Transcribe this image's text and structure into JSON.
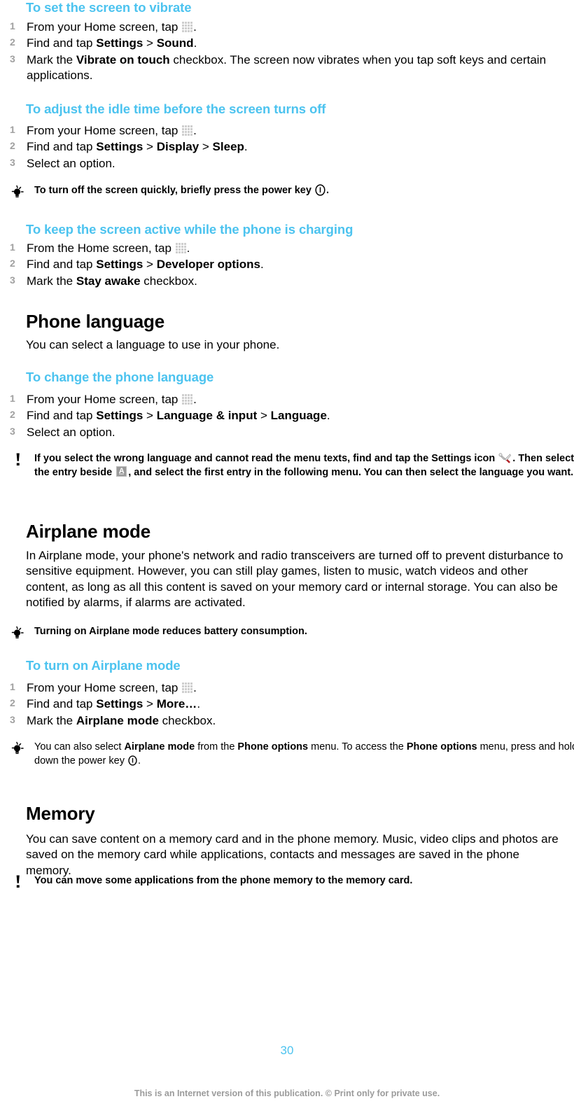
{
  "document": {
    "page_number": "30",
    "footer_note": "This is an Internet version of this publication. © Print only for private use.",
    "accent_color": "#4cc3ef",
    "step_number_color": "#a0a0a0"
  },
  "icons": {
    "app_drawer": "app-drawer-grid-icon",
    "power_key": "power-key-icon",
    "settings_wrench": "settings-wrench-icon",
    "keyboard_a": "keyboard-language-icon",
    "tip": "tip-lightbulb-icon",
    "note": "note-exclamation-icon"
  },
  "procedures": {
    "vibrate": {
      "title": "To set the screen to vibrate",
      "steps": [
        {
          "num": "1",
          "pre": "From your Home screen, tap ",
          "icon": "app_drawer",
          "post": "."
        },
        {
          "num": "2",
          "pre": "Find and tap ",
          "bold1": "Settings",
          "sep": " > ",
          "bold2": "Sound",
          "post": "."
        },
        {
          "num": "3",
          "pre": "Mark the ",
          "bold1": "Vibrate on touch",
          "post": " checkbox. The screen now vibrates when you tap soft keys and certain applications."
        }
      ]
    },
    "idle_time": {
      "title": "To adjust the idle time before the screen turns off",
      "steps": [
        {
          "num": "1",
          "pre": "From your Home screen, tap ",
          "icon": "app_drawer",
          "post": "."
        },
        {
          "num": "2",
          "pre": "Find and tap ",
          "bold1": "Settings",
          "sep": " > ",
          "bold2": "Display",
          "sep2": " > ",
          "bold3": "Sleep",
          "post": "."
        },
        {
          "num": "3",
          "pre": "Select an option.",
          "post": ""
        }
      ],
      "tip": {
        "type": "tip",
        "pre": "To turn off the screen quickly, briefly press the power key ",
        "icon": "power_key",
        "post": "."
      }
    },
    "screen_active": {
      "title": "To keep the screen active while the phone is charging",
      "steps": [
        {
          "num": "1",
          "pre": "From the Home screen, tap ",
          "icon": "app_drawer",
          "post": "."
        },
        {
          "num": "2",
          "pre": "Find and tap ",
          "bold1": "Settings",
          "sep": " > ",
          "bold2": "Developer options",
          "post": "."
        },
        {
          "num": "3",
          "pre": "Mark the ",
          "bold1": "Stay awake",
          "post": " checkbox."
        }
      ]
    },
    "change_language": {
      "title": "To change the phone language",
      "steps": [
        {
          "num": "1",
          "pre": "From your Home screen, tap ",
          "icon": "app_drawer",
          "post": "."
        },
        {
          "num": "2",
          "pre": "Find and tap ",
          "bold1": "Settings",
          "sep": " > ",
          "bold2": "Language & input",
          "sep2": " > ",
          "bold3": "Language",
          "post": "."
        },
        {
          "num": "3",
          "pre": "Select an option.",
          "post": ""
        }
      ],
      "note": {
        "type": "note",
        "part1": "If you select the wrong language and cannot read the menu texts, find and tap the ",
        "bold1": "Settings",
        "part2": " icon ",
        "icon1": "settings_wrench",
        "part3": ". Then select the entry beside ",
        "icon2": "keyboard_a",
        "part4": ", and select the first entry in the following menu. You can then select the language you want."
      }
    },
    "airplane_on": {
      "title": "To turn on Airplane mode",
      "steps": [
        {
          "num": "1",
          "pre": "From your Home screen, tap ",
          "icon": "app_drawer",
          "post": "."
        },
        {
          "num": "2",
          "pre": "Find and tap ",
          "bold1": "Settings",
          "sep": " > ",
          "bold2": "More…",
          "post": "."
        },
        {
          "num": "3",
          "pre": "Mark the ",
          "bold1": "Airplane mode",
          "post": " checkbox."
        }
      ],
      "tip": {
        "type": "tip",
        "part1": "You can also select ",
        "bold1": "Airplane mode",
        "part2": " from the ",
        "bold2": "Phone options",
        "part3": " menu. To access the ",
        "bold3": "Phone options",
        "part4": " menu, press and hold down the power key ",
        "icon": "power_key",
        "part5": "."
      }
    }
  },
  "sections": {
    "phone_language": {
      "heading": "Phone language",
      "body": "You can select a language to use in your phone."
    },
    "airplane_mode": {
      "heading": "Airplane mode",
      "body": "In Airplane mode, your phone's network and radio transceivers are turned off to prevent disturbance to sensitive equipment. However, you can still play games, listen to music, watch videos and other content, as long as all this content is saved on your memory card or internal storage. You can also be notified by alarms, if alarms are activated.",
      "tip": "Turning on Airplane mode reduces battery consumption."
    },
    "memory": {
      "heading": "Memory",
      "body": "You can save content on a memory card and in the phone memory. Music, video clips and photos are saved on the memory card while applications, contacts and messages are saved in the phone memory.",
      "note": "You can move some applications from the phone memory to the memory card."
    }
  }
}
